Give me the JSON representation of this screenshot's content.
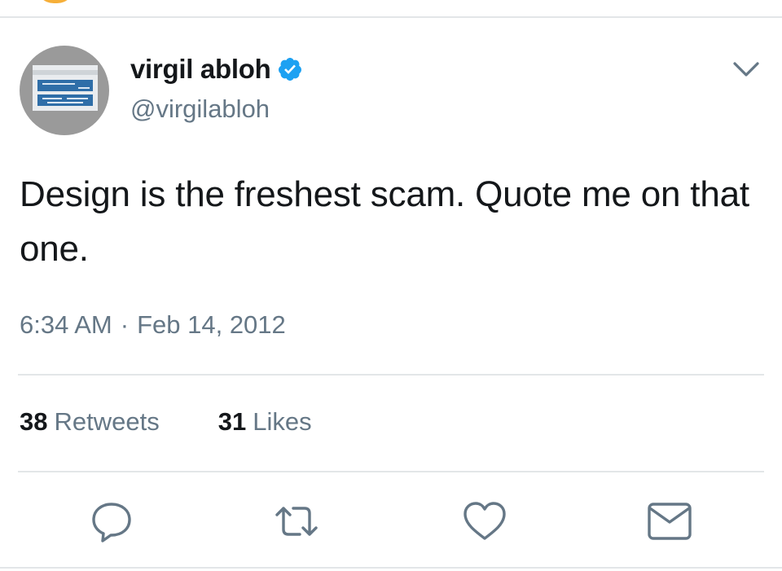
{
  "tweet": {
    "author": {
      "display_name": "virgil abloh",
      "handle": "@virgilabloh",
      "verified": true
    },
    "text": "Design is the freshest scam. Quote me on that one.",
    "time": "6:34 AM",
    "separator": "·",
    "date": "Feb 14, 2012",
    "stats": {
      "retweets_count": "38",
      "retweets_label": "Retweets",
      "likes_count": "31",
      "likes_label": "Likes"
    },
    "actions": {
      "reply_icon": "speech-bubble-icon",
      "retweet_icon": "retweet-arrows-icon",
      "like_icon": "heart-icon",
      "dm_icon": "envelope-icon"
    }
  },
  "colors": {
    "text_primary": "#14171a",
    "text_secondary": "#657786",
    "verified_blue": "#1da1f2",
    "divider": "#e3e6e8",
    "icon_gray": "#657786"
  }
}
